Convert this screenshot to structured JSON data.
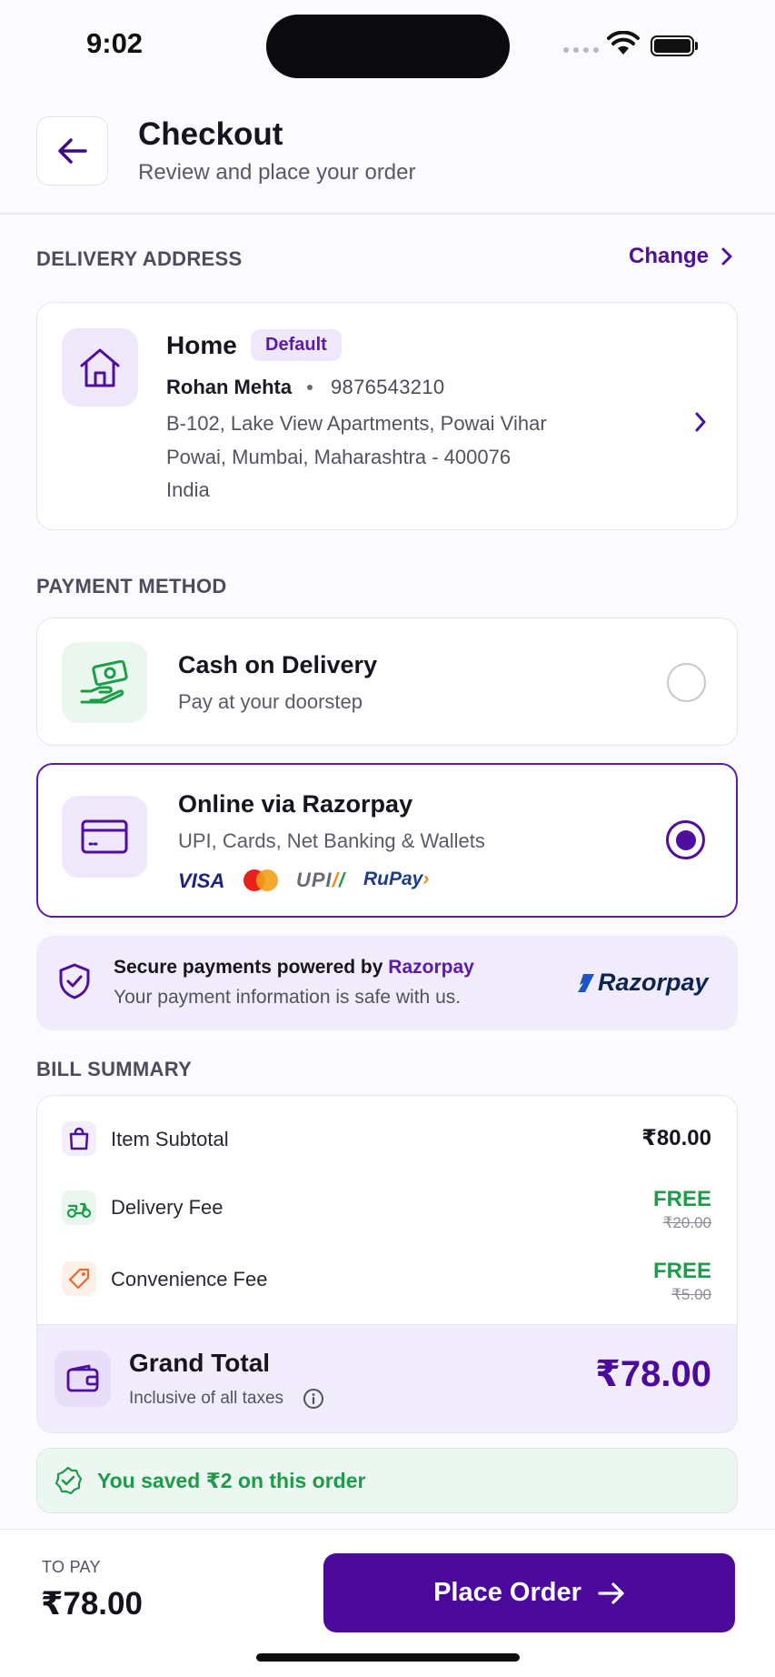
{
  "status_bar": {
    "time": "9:02"
  },
  "header": {
    "title": "Checkout",
    "subtitle": "Review and place your order"
  },
  "delivery": {
    "section_label": "DELIVERY ADDRESS",
    "change_label": "Change",
    "label": "Home",
    "badge": "Default",
    "name": "Rohan Mehta",
    "phone": "9876543210",
    "line1": "B-102, Lake View Apartments, Powai Vihar",
    "line2": "Powai, Mumbai, Maharashtra - 400076",
    "line3": "India"
  },
  "payment": {
    "section_label": "PAYMENT METHOD",
    "methods": [
      {
        "title": "Cash on Delivery",
        "subtitle": "Pay at your doorstep",
        "selected": false
      },
      {
        "title": "Online via Razorpay",
        "subtitle": "UPI, Cards, Net Banking & Wallets",
        "selected": true
      }
    ],
    "brands": {
      "visa": "VISA",
      "upi": "UPI",
      "rupay": "RuPay"
    }
  },
  "secure": {
    "prefix": "Secure payments powered by ",
    "highlight": "Razorpay",
    "subtitle": "Your payment information is safe with us.",
    "logo_text": "Razorpay"
  },
  "bill": {
    "section_label": "BILL SUMMARY",
    "rows": [
      {
        "label": "Item Subtotal",
        "value": "₹80.00"
      },
      {
        "label": "Delivery Fee",
        "value": "FREE",
        "original": "₹20.00"
      },
      {
        "label": "Convenience Fee",
        "value": "FREE",
        "original": "₹5.00"
      }
    ],
    "grand_total_label": "Grand Total",
    "grand_total_sub": "Inclusive of all taxes",
    "grand_total_value": "₹78.00",
    "savings_text": "You saved ₹2 on this order"
  },
  "footer": {
    "to_pay_label": "TO PAY",
    "to_pay_amount": "₹78.00",
    "place_order_label": "Place Order"
  },
  "colors": {
    "brand_purple": "#4b0a9c",
    "accent_green": "#1c9d48",
    "tint_purple": "#f1ecfb"
  }
}
